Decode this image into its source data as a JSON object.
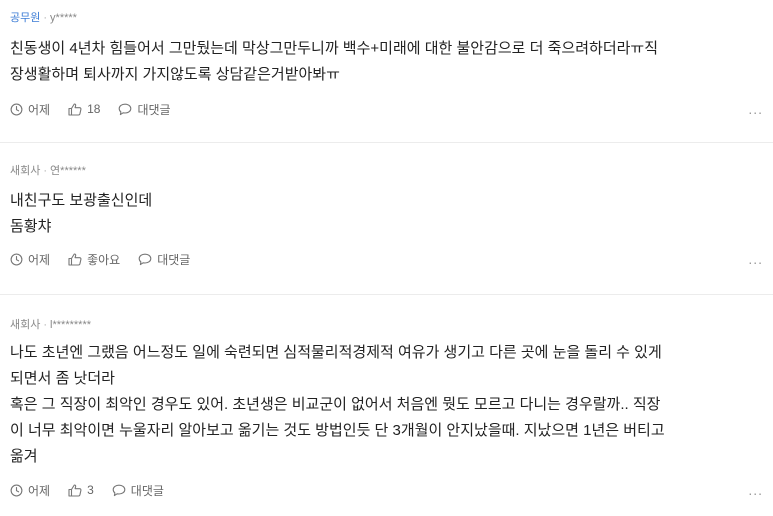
{
  "comments": [
    {
      "company": "공무원",
      "author": "y*****",
      "text": "친동생이 4년차 힘들어서 그만뒀는데 막상그만두니까 백수+미래에 대한 불안감으로 더 죽으려하더라ㅠ직\n장생활하며 퇴사까지 가지않도록 상담같은거받아봐ㅠ",
      "time": "어제",
      "likes": "18",
      "reply": "대댓글",
      "more": "..."
    },
    {
      "company": "새회사",
      "author": "연******",
      "text": "내친구도 보광출신인데\n돔황챠",
      "time": "어제",
      "likes": "좋아요",
      "reply": "대댓글",
      "more": "..."
    },
    {
      "company": "새회사",
      "author": "l*********",
      "text": "나도 초년엔 그랬음 어느정도 일에 숙련되면 심적물리적경제적 여유가 생기고 다른 곳에 눈을 돌리 수 있게\n되면서 좀 낫더라\n혹은 그 직장이 최악인 경우도 있어. 초년생은 비교군이 없어서 처음엔 뭣도 모르고 다니는 경우랄까.. 직장\n이 너무 최악이면 누울자리 알아보고 옮기는 것도 방법인듯 단 3개월이 안지났을때. 지났으면 1년은 버티고\n옮겨",
      "time": "어제",
      "likes": "3",
      "reply": "대댓글",
      "more": "..."
    }
  ]
}
